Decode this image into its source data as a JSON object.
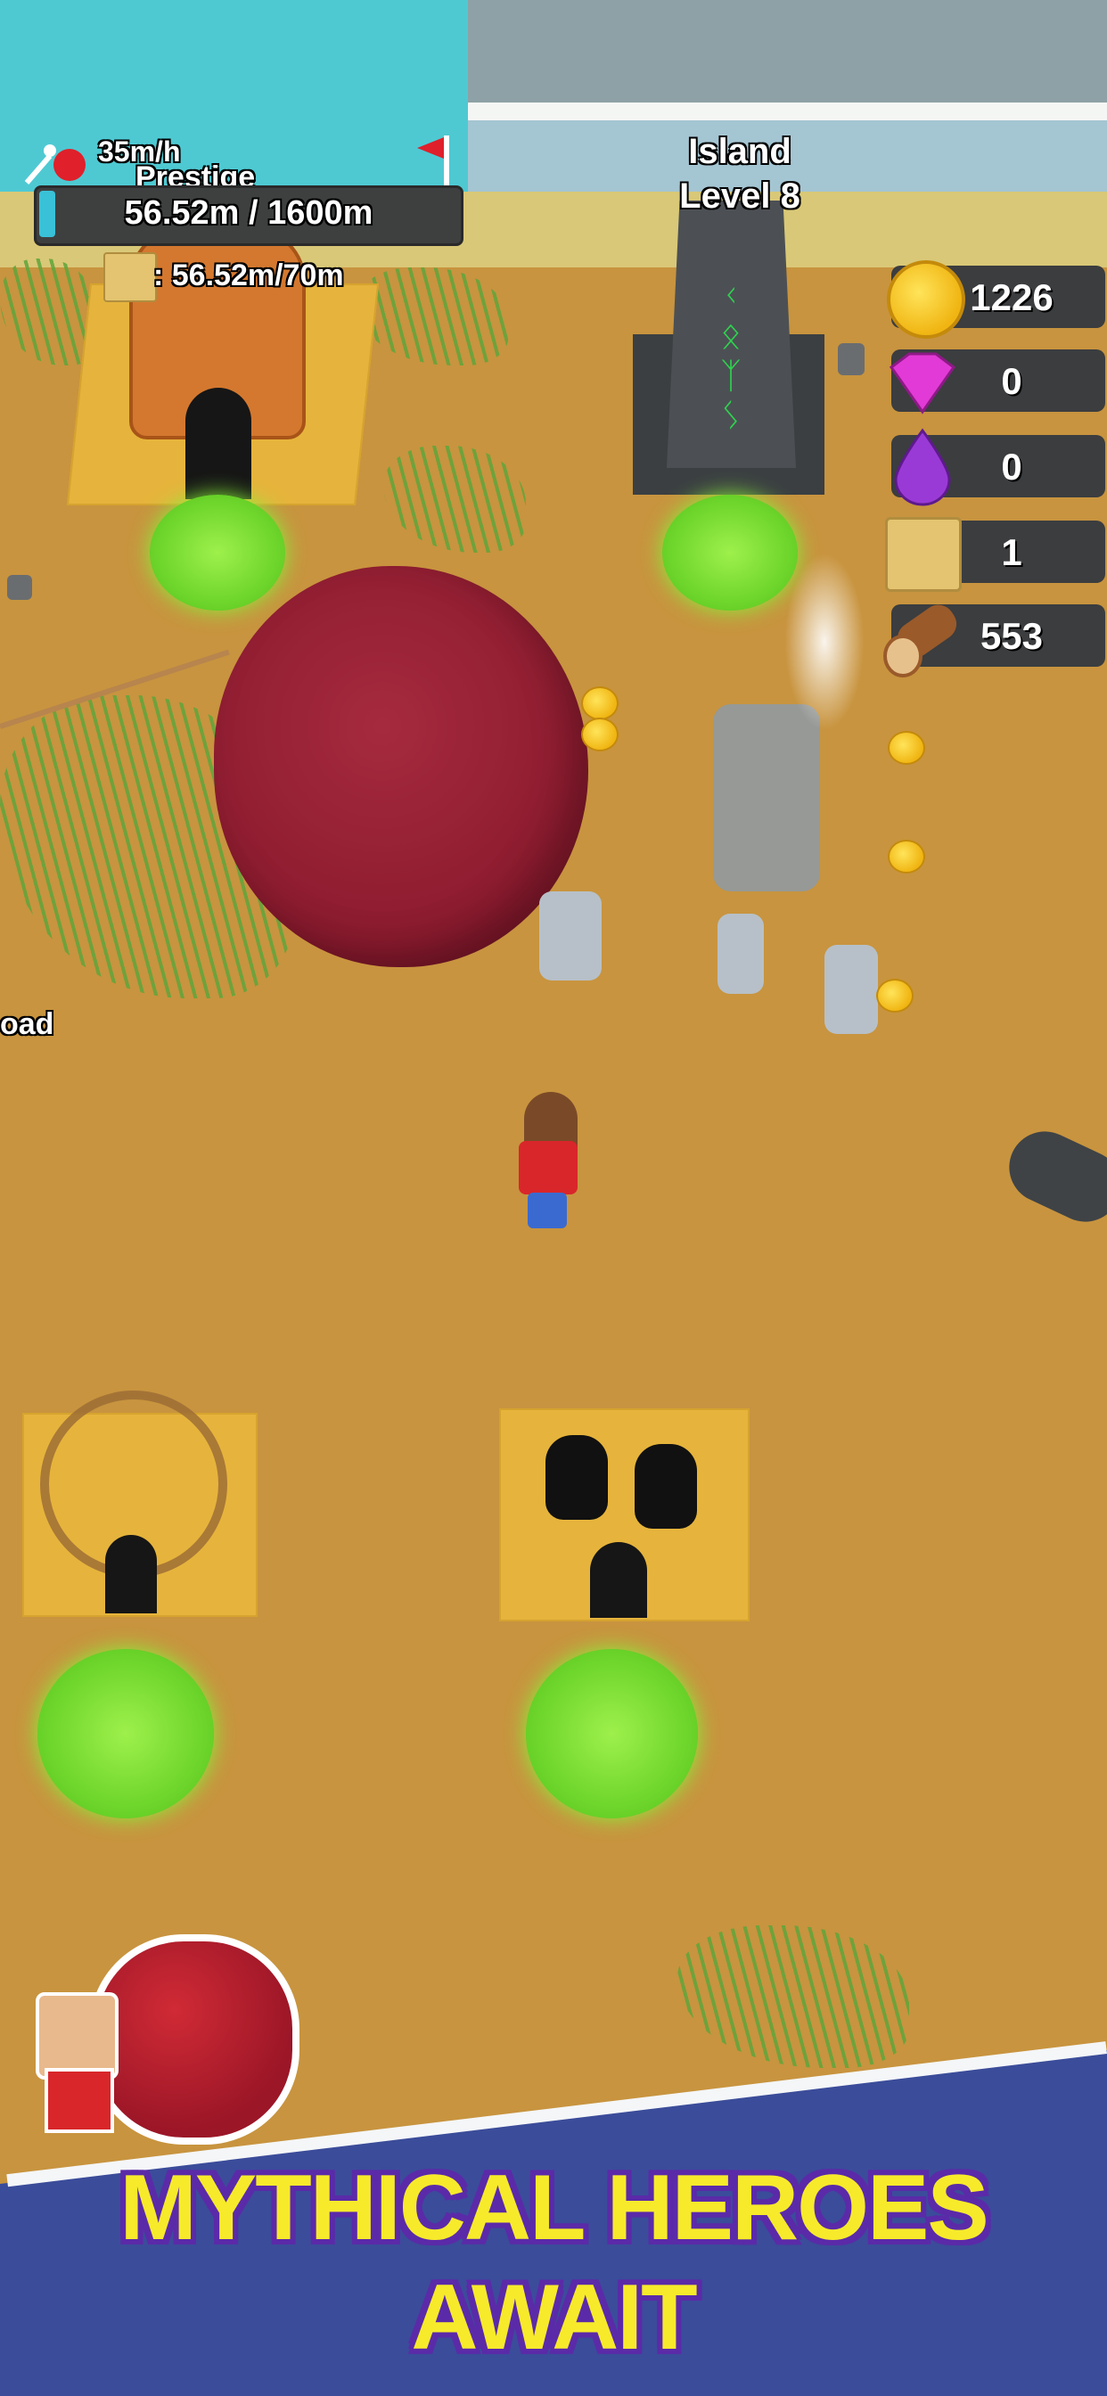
{
  "hud": {
    "rate": "35m/h",
    "prestige_label": "Prestige",
    "progress_text": "56.52m / 1600m",
    "map_progress": ": 56.52m/70m"
  },
  "island": {
    "title": "Island",
    "level": "Level 8"
  },
  "resources": [
    {
      "name": "gold-coin-icon",
      "value": "1226"
    },
    {
      "name": "gem-icon",
      "value": "0"
    },
    {
      "name": "purple-drop-icon",
      "value": "0"
    },
    {
      "name": "treasure-map-icon",
      "value": "1"
    },
    {
      "name": "wood-log-icon",
      "value": "553"
    }
  ],
  "world": {
    "edge_label": "oad"
  },
  "banner": {
    "line1": "MYTHICAL HEROES",
    "line2": "AWAIT"
  },
  "colors": {
    "sand": "#c8943f",
    "water": "#4ec9d2",
    "boulder": "#9b1e33",
    "pad": "#6fd62c",
    "banner_bg": "#3b4c9a",
    "banner_text": "#f7ea2b",
    "banner_outline": "#5b2aa8"
  }
}
